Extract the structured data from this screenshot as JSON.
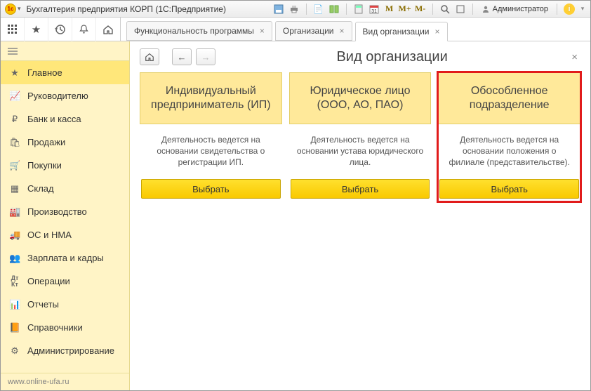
{
  "titlebar": {
    "app_title": "Бухгалтерия предприятия КОРП  (1С:Предприятие)",
    "user_label": "Администратор"
  },
  "toolbar_icons": {
    "m": "M",
    "mplus": "M+",
    "mminus": "M-"
  },
  "tabs": [
    {
      "label": "Функциональность программы",
      "active": false
    },
    {
      "label": "Организации",
      "active": false
    },
    {
      "label": "Вид организации",
      "active": true
    }
  ],
  "sidebar": {
    "items": [
      {
        "icon": "star",
        "label": "Главное",
        "active": true
      },
      {
        "icon": "chart",
        "label": "Руководителю"
      },
      {
        "icon": "ruble",
        "label": "Банк и касса"
      },
      {
        "icon": "bag",
        "label": "Продажи"
      },
      {
        "icon": "cart",
        "label": "Покупки"
      },
      {
        "icon": "boxes",
        "label": "Склад"
      },
      {
        "icon": "factory",
        "label": "Производство"
      },
      {
        "icon": "truck",
        "label": "ОС и НМА"
      },
      {
        "icon": "people",
        "label": "Зарплата и кадры"
      },
      {
        "icon": "dtkt",
        "label": "Операции"
      },
      {
        "icon": "bars",
        "label": "Отчеты"
      },
      {
        "icon": "book",
        "label": "Справочники"
      },
      {
        "icon": "gear",
        "label": "Администрирование"
      }
    ],
    "footer": "www.online-ufa.ru"
  },
  "page": {
    "title": "Вид организации",
    "cards": [
      {
        "title": "Индивидуальный предприниматель (ИП)",
        "desc": "Деятельность ведется на основании свидетельства о регистрации ИП.",
        "button": "Выбрать",
        "highlight": false
      },
      {
        "title": "Юридическое лицо (ООО, АО, ПАО)",
        "desc": "Деятельность ведется на основании устава юридического лица.",
        "button": "Выбрать",
        "highlight": false
      },
      {
        "title": "Обособленное подразделение",
        "desc": "Деятельность ведется на основании положения о филиале (представительстве).",
        "button": "Выбрать",
        "highlight": true
      }
    ]
  }
}
